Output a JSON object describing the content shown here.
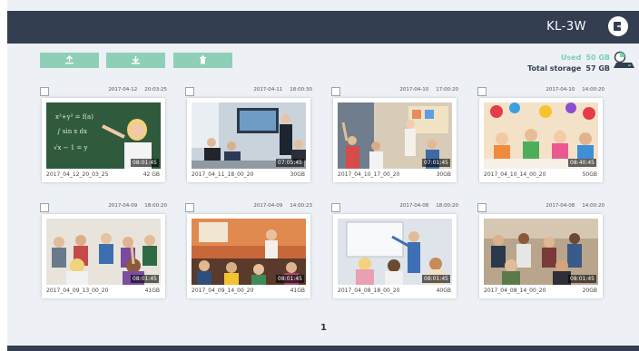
{
  "header": {
    "device_name": "KL-3W",
    "logout_icon": "logout-icon"
  },
  "toolbar": {
    "upload_icon": "upload-icon",
    "download_icon": "download-icon",
    "delete_icon": "trash-icon"
  },
  "storage": {
    "used_label": "Used",
    "used_value": "50 GB",
    "total_label": "Total storage",
    "total_value": "57 GB",
    "icon": "drive-icon"
  },
  "colors": {
    "header_bg": "#333e50",
    "accent": "#8ed0b7",
    "page_bg": "#edf1f5"
  },
  "recordings": [
    {
      "date": "2017-04-12",
      "time": "20:03:25",
      "file": "2017_04_12_20_03_25",
      "size": "42 GB",
      "duration": "08:01:45"
    },
    {
      "date": "2017-04-11",
      "time": "18:00:30",
      "file": "2017_04_11_18_00_20",
      "size": "30GB",
      "duration": "07:05:45"
    },
    {
      "date": "2017-04-10",
      "time": "17:00:20",
      "file": "2017_04_10_17_00_20",
      "size": "30GB",
      "duration": "07:01:45"
    },
    {
      "date": "2017-04-10",
      "time": "14:00:20",
      "file": "2017_04_10_14_00_20",
      "size": "50GB",
      "duration": "08:40:45"
    },
    {
      "date": "2017-04-09",
      "time": "18:00:20",
      "file": "2017_04_09_13_00_20",
      "size": "41GB",
      "duration": "08:01:45"
    },
    {
      "date": "2017-04-09",
      "time": "14:00:23",
      "file": "2017_04_09_14_00_20",
      "size": "41GB",
      "duration": "08:01:45"
    },
    {
      "date": "2017-04-08",
      "time": "18:00:20",
      "file": "2017_04_08_18_00_20",
      "size": "40GB",
      "duration": "08:01:45"
    },
    {
      "date": "2017-04-08",
      "time": "14:00:20",
      "file": "2017_04_08_14_00_20",
      "size": "20GB",
      "duration": "08:01:45"
    }
  ],
  "pagination": {
    "current": "1"
  }
}
